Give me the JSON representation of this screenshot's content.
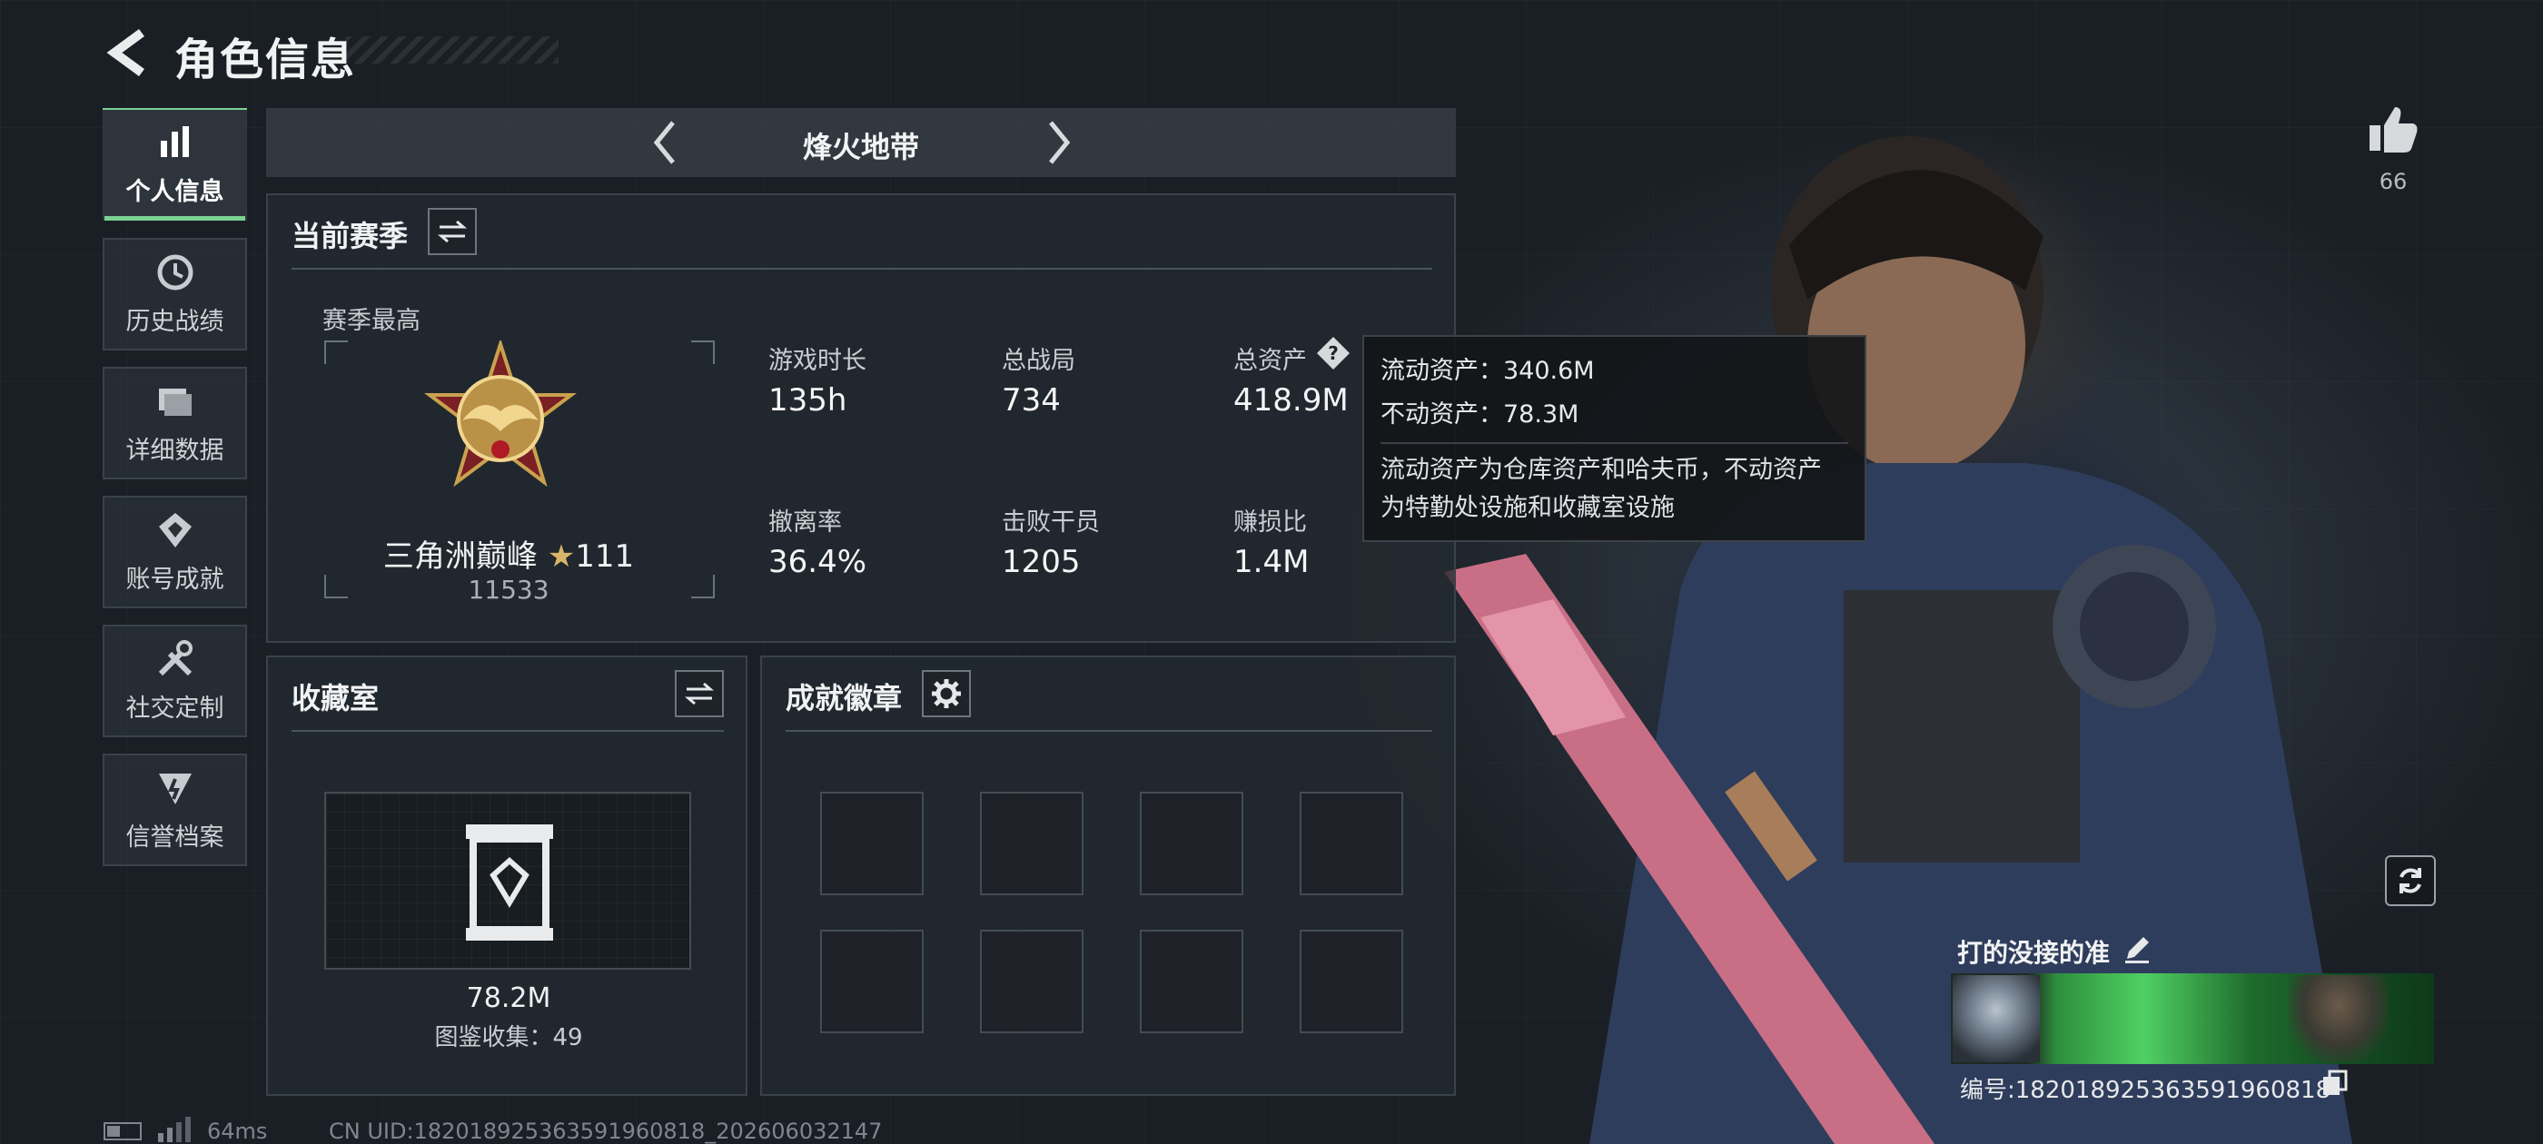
{
  "header": {
    "title": "角色信息"
  },
  "nav": [
    {
      "label": "个人信息",
      "icon": "bar-chart-icon",
      "active": true
    },
    {
      "label": "历史战绩",
      "icon": "history-clock-icon",
      "active": false
    },
    {
      "label": "详细数据",
      "icon": "folder-icon",
      "active": false
    },
    {
      "label": "账号成就",
      "icon": "achievement-icon",
      "active": false
    },
    {
      "label": "社交定制",
      "icon": "tools-icon",
      "active": false
    },
    {
      "label": "信誉档案",
      "icon": "reputation-icon",
      "active": false
    }
  ],
  "mode": {
    "title": "烽火地带"
  },
  "season": {
    "title": "当前赛季",
    "best_label": "赛季最高",
    "rank_name": "三角洲巅峰",
    "rank_stars": "111",
    "rank_score": "11533",
    "stats": [
      {
        "label": "游戏时长",
        "value": "135h"
      },
      {
        "label": "总战局",
        "value": "734"
      },
      {
        "label": "总资产",
        "value": "418.9M"
      },
      {
        "label": "撤离率",
        "value": "36.4%"
      },
      {
        "label": "击败干员",
        "value": "1205"
      },
      {
        "label": "赚损比",
        "value": "1.4M"
      }
    ]
  },
  "tooltip": {
    "liquid": "流动资产：340.6M",
    "fixed": "不动资产：78.3M",
    "desc_line1": "流动资产为仓库资产和哈夫币，不动资产",
    "desc_line2": "为特勤处设施和收藏室设施"
  },
  "collection": {
    "title": "收藏室",
    "value": "78.2M",
    "count_text": "图鉴收集：49"
  },
  "badges": {
    "title": "成就徽章",
    "slots": 8
  },
  "like": {
    "count": "66"
  },
  "player": {
    "name": "打的没接的准",
    "id_text": "编号:18201892536359196081​8"
  },
  "footer": {
    "ping": "64ms",
    "uid": "CN UID:18201892536359196081​8_202606032147"
  },
  "colors": {
    "accent": "#7ad391",
    "rank_star": "#d9b56a"
  }
}
